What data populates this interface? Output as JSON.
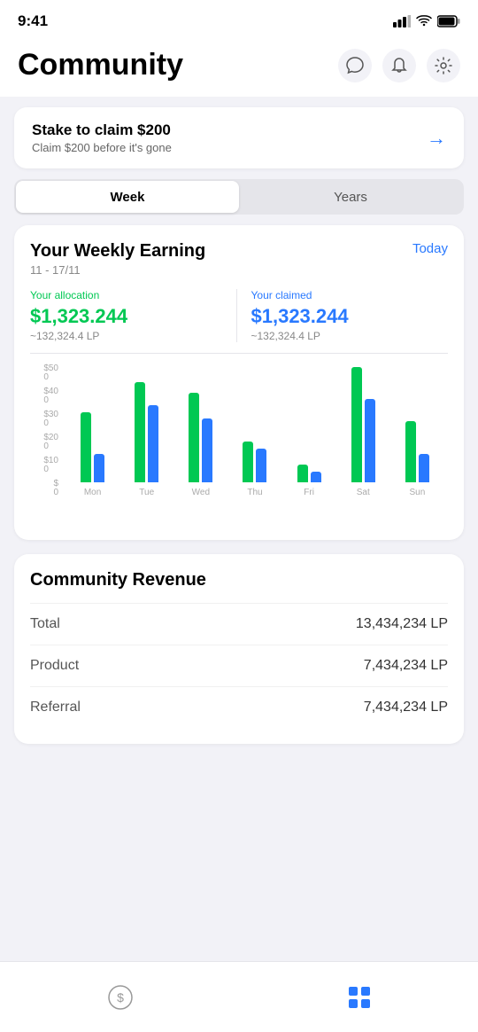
{
  "statusBar": {
    "time": "9:41"
  },
  "header": {
    "title": "Community",
    "actions": [
      "message",
      "bell",
      "gear"
    ]
  },
  "promoBanner": {
    "title": "Stake to claim $200",
    "subtitle": "Claim $200 before it's gone",
    "arrow": "→"
  },
  "tabs": {
    "items": [
      "Week",
      "Years"
    ],
    "activeIndex": 0
  },
  "weeklyEarning": {
    "title": "Your Weekly Earning",
    "dateRange": "11 - 17/11",
    "todayLabel": "Today",
    "allocation": {
      "label": "Your allocation",
      "amount": "$1,323.244",
      "lp": "~132,324.4 LP"
    },
    "claimed": {
      "label": "Your claimed",
      "amount": "$1,323.244",
      "lp": "~132,324.4 LP"
    },
    "chart": {
      "yLabels": [
        "$50\n0",
        "$40\n0",
        "$30\n0",
        "$20\n0",
        "$10\n0",
        "$\n0"
      ],
      "days": [
        {
          "label": "Mon",
          "green": 55,
          "blue": 22
        },
        {
          "label": "Tue",
          "green": 78,
          "blue": 60
        },
        {
          "label": "Wed",
          "green": 70,
          "blue": 50
        },
        {
          "label": "Thu",
          "green": 32,
          "blue": 26
        },
        {
          "label": "Fri",
          "green": 14,
          "blue": 8
        },
        {
          "label": "Sat",
          "green": 90,
          "blue": 65
        },
        {
          "label": "Sun",
          "green": 48,
          "blue": 22
        }
      ]
    }
  },
  "communityRevenue": {
    "title": "Community Revenue",
    "rows": [
      {
        "label": "Total",
        "value": "13,434,234 LP"
      },
      {
        "label": "Product",
        "value": "7,434,234 LP"
      },
      {
        "label": "Referral",
        "value": "7,434,234 LP"
      }
    ]
  },
  "bottomNav": {
    "items": [
      "dollar-icon",
      "grid-icon"
    ]
  },
  "colors": {
    "green": "#00c853",
    "blue": "#2979ff",
    "accent": "#2979ff"
  }
}
